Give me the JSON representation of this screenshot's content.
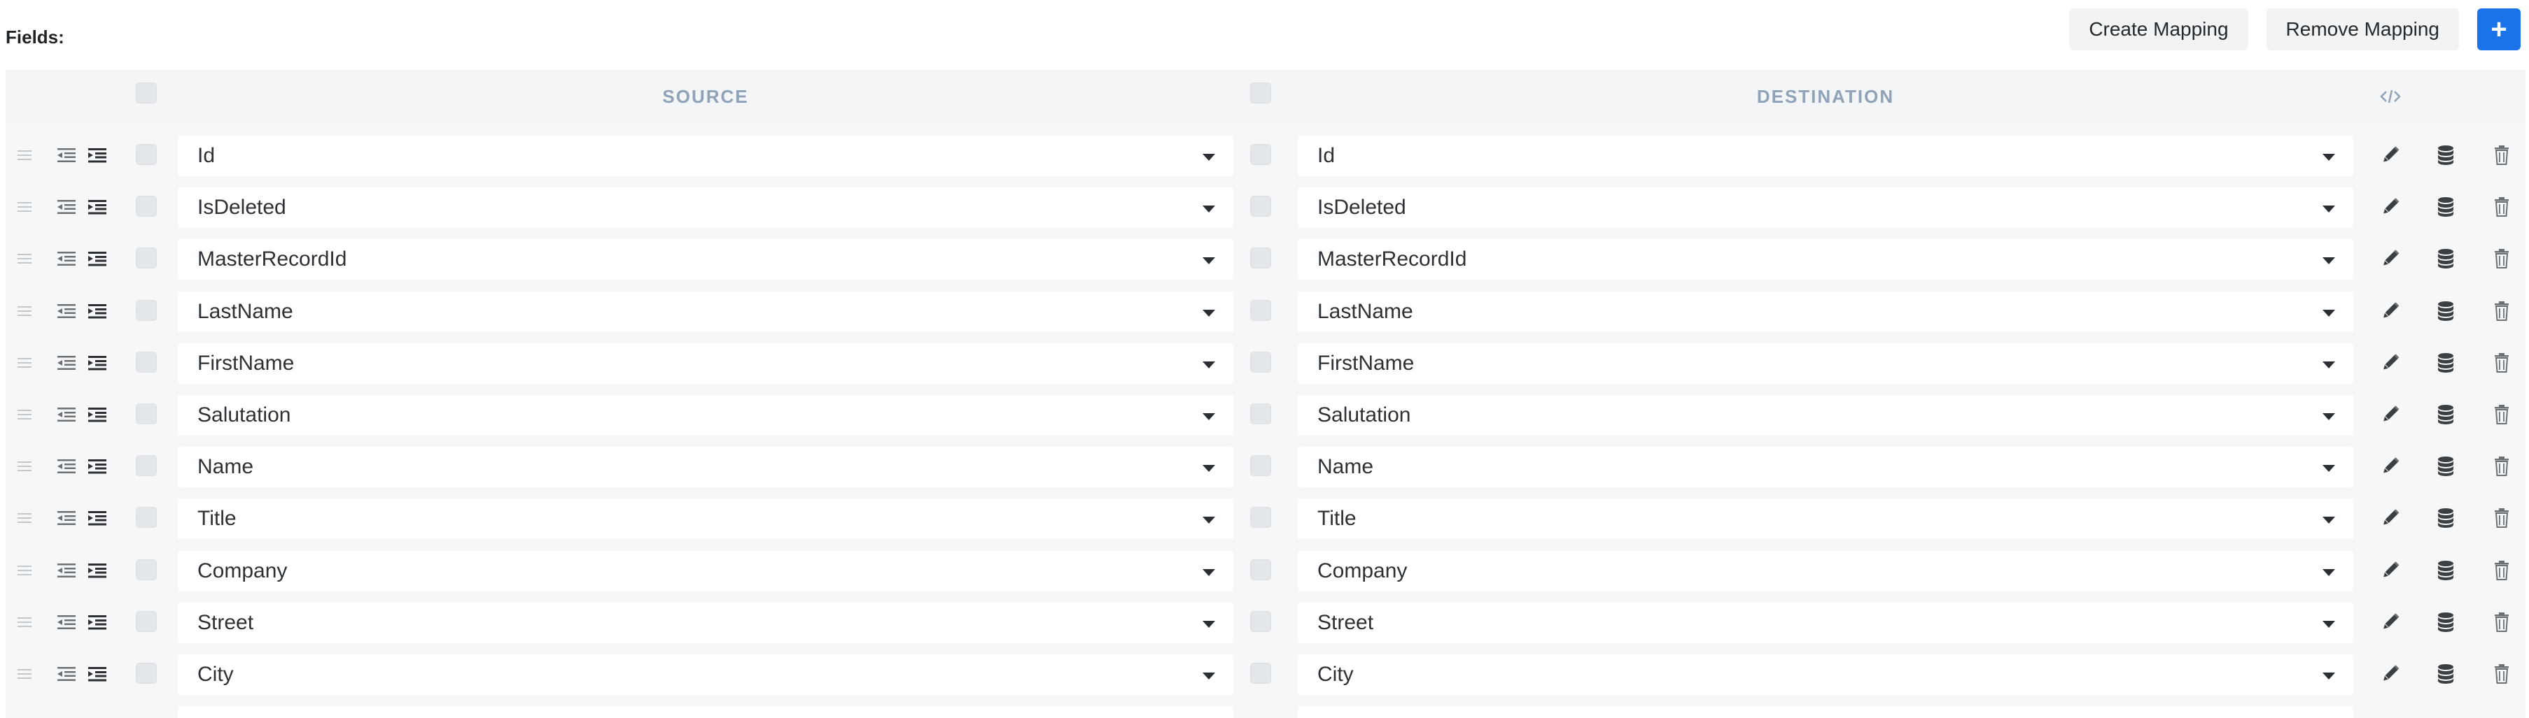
{
  "header": {
    "fields_label": "Fields:",
    "create_mapping_label": "Create Mapping",
    "remove_mapping_label": "Remove Mapping",
    "add_label": "+"
  },
  "grid": {
    "source_header": "SOURCE",
    "destination_header": "DESTINATION",
    "code_icon": "code-icon",
    "rows": [
      {
        "source": "Id",
        "destination": "Id"
      },
      {
        "source": "IsDeleted",
        "destination": "IsDeleted"
      },
      {
        "source": "MasterRecordId",
        "destination": "MasterRecordId"
      },
      {
        "source": "LastName",
        "destination": "LastName"
      },
      {
        "source": "FirstName",
        "destination": "FirstName"
      },
      {
        "source": "Salutation",
        "destination": "Salutation"
      },
      {
        "source": "Name",
        "destination": "Name"
      },
      {
        "source": "Title",
        "destination": "Title"
      },
      {
        "source": "Company",
        "destination": "Company"
      },
      {
        "source": "Street",
        "destination": "Street"
      },
      {
        "source": "City",
        "destination": "City"
      }
    ],
    "row_icons": [
      "drag-handle-icon",
      "outdent-icon",
      "indent-icon",
      "edit-icon",
      "database-icon",
      "trash-icon"
    ]
  },
  "colors": {
    "accent": "#1a73e8",
    "header_text": "#8fa3b8",
    "grid_background": "#f6f7f9"
  }
}
